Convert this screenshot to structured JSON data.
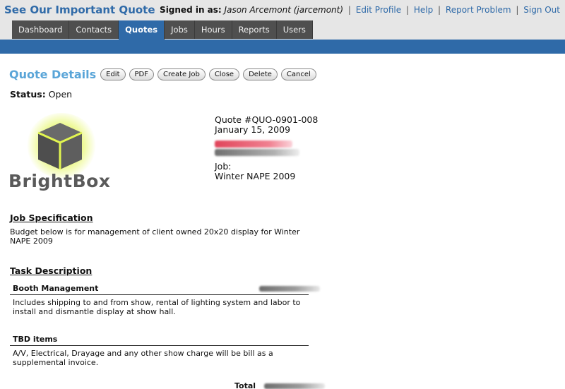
{
  "header": {
    "app_title": "See Our Important Quote",
    "signed_in_label": "Signed in as:",
    "user_name": "Jason Arcemont (jarcemont)",
    "links": [
      "Edit Profile",
      "Help",
      "Report Problem",
      "Sign Out"
    ]
  },
  "nav": {
    "tabs": [
      "Dashboard",
      "Contacts",
      "Quotes",
      "Jobs",
      "Hours",
      "Reports",
      "Users"
    ],
    "active": "Quotes"
  },
  "page": {
    "title": "Quote Details",
    "buttons": [
      "Edit",
      "PDF",
      "Create Job",
      "Close",
      "Delete",
      "Cancel"
    ],
    "status_label": "Status:",
    "status_value": "Open"
  },
  "logo": {
    "text": "BrightBox"
  },
  "quote": {
    "number": "Quote #QUO-0901-008",
    "date": "January 15, 2009",
    "job_label": "Job:",
    "job_name": "Winter NAPE 2009"
  },
  "job_spec": {
    "heading": "Job Specification",
    "text": "Budget below is for management of client owned 20x20 display for Winter NAPE 2009"
  },
  "tasks": {
    "heading": "Task Description",
    "items": [
      {
        "name": "Booth Management",
        "description": "Includes shipping to and from show, rental of lighting system and labor to install and dismantle display at show hall."
      },
      {
        "name": "TBD items",
        "description": "A/V, Electrical, Drayage and any other show charge will be bill as a supplemental invoice."
      }
    ],
    "total_label": "Total"
  },
  "colors": {
    "brand_blue": "#2f6aa8",
    "title_blue": "#5aa5d8",
    "tab_gray": "#4f4f4f",
    "logo_glow": "#e2f550"
  }
}
